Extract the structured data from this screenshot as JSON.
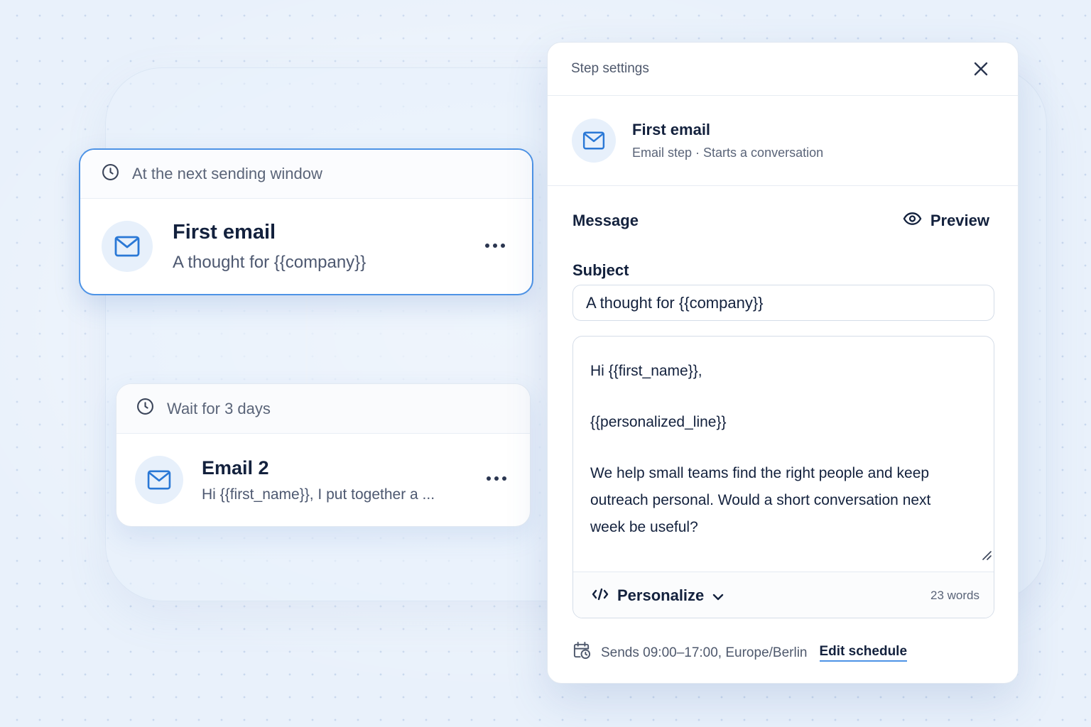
{
  "colors": {
    "accent": "#4d93e6",
    "icon_blue": "#2a78d6",
    "icon_bg": "#e7f0fb",
    "text_dark": "#13213d",
    "text_muted": "#5a6478",
    "background": "#e9f1fb"
  },
  "flow": {
    "steps": [
      {
        "timing": "At the next sending window",
        "timing_icon": "clock-icon",
        "icon": "mail-icon",
        "title": "First email",
        "subtitle": "A thought for {{company}}",
        "menu_icon": "more-horizontal-icon",
        "selected": true
      },
      {
        "timing": "Wait for 3 days",
        "timing_icon": "clock-icon",
        "icon": "mail-icon",
        "title": "Email 2",
        "subtitle": "Hi {{first_name}}, I put together a ...",
        "menu_icon": "more-horizontal-icon",
        "selected": false
      }
    ]
  },
  "panel": {
    "title": "Step settings",
    "close_icon": "close-icon",
    "step": {
      "icon": "mail-icon",
      "name": "First email",
      "description": "Email step · Starts a conversation"
    },
    "message": {
      "section_title": "Message",
      "preview_label": "Preview",
      "preview_icon": "eye-icon",
      "subject_label": "Subject",
      "subject_value": "A thought for {{company}}",
      "body_lines": [
        "Hi {{first_name}},",
        "",
        "{{personalized_line}}",
        "",
        "We help small teams find the right people and keep",
        "outreach personal. Would a short conversation next",
        "week be useful?"
      ],
      "personalize_label": "Personalize",
      "personalize_icon": "code-icon",
      "personalize_chevron": "chevron-down-icon",
      "word_count": "23 words"
    },
    "schedule": {
      "icon": "calendar-clock-icon",
      "text": "Sends 09:00–17:00, Europe/Berlin",
      "edit_label": "Edit schedule"
    }
  }
}
